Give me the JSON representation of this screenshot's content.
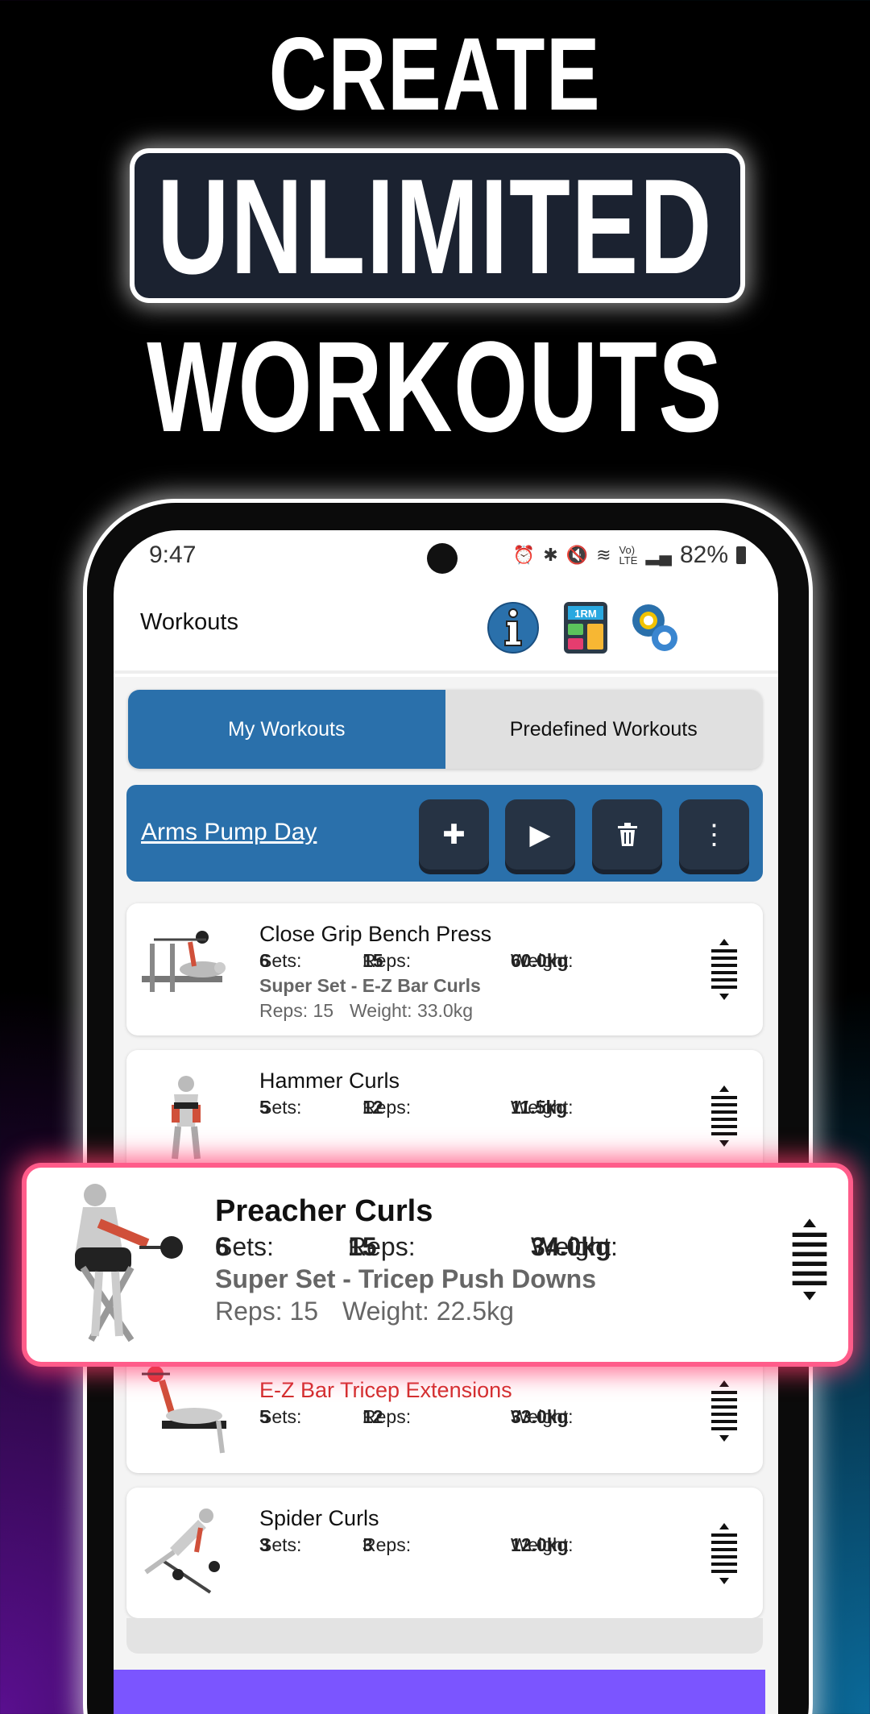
{
  "headline": {
    "line1": "CREATE",
    "line2": "UNLIMITED",
    "line3": "WORKOUTS"
  },
  "status": {
    "time": "9:47",
    "battery": "82%",
    "icons": [
      "alarm-icon",
      "bluetooth-icon",
      "mute-icon",
      "wifi-icon",
      "volte-icon",
      "signal-icon",
      "battery-icon"
    ]
  },
  "appbar": {
    "title": "Workouts",
    "icons": [
      "info-icon",
      "1rm-calculator-icon",
      "settings-icon"
    ],
    "calc_label": "1RM"
  },
  "tabs": [
    {
      "label": "My Workouts",
      "active": true
    },
    {
      "label": "Predefined Workouts",
      "active": false
    }
  ],
  "workout": {
    "name": "Arms Pump Day",
    "buttons": [
      "add",
      "play",
      "delete",
      "more"
    ]
  },
  "labels": {
    "sets": "Sets:",
    "reps": "Reps:",
    "weight": "Weight:"
  },
  "exercises": [
    {
      "name": "Close Grip Bench Press",
      "sets": "6",
      "reps": "15",
      "weight": "60.0kg",
      "superset": "Super Set - E-Z Bar Curls",
      "ss_reps": "Reps: 15",
      "ss_weight": "Weight: 33.0kg"
    },
    {
      "name": "Hammer Curls",
      "sets": "5",
      "reps": "12",
      "weight": "11.5kg"
    },
    {
      "name": "E-Z Bar Tricep Extensions",
      "sets": "5",
      "reps": "12",
      "weight": "33.0kg"
    },
    {
      "name": "Spider Curls",
      "sets": "3",
      "reps": "3",
      "weight": "12.0kg"
    }
  ],
  "dragged": {
    "name": "Preacher Curls",
    "sets": "6",
    "reps": "15",
    "weight": "34.0kg",
    "superset": "Super Set - Tricep Push Downs",
    "ss_reps": "Reps: 15",
    "ss_weight": "Weight: 22.5kg"
  },
  "colors": {
    "primary": "#2a70ab",
    "highlight": "#ff5c8a",
    "dragging_name": "#d32f2f",
    "nav": "#7b55ff"
  }
}
